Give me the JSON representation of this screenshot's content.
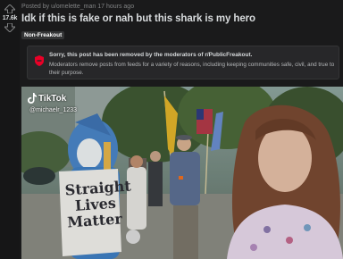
{
  "vote": {
    "score": "17.6k"
  },
  "post": {
    "meta": "Posted by u/omelette_man 17 hours ago",
    "title": "Idk if this is fake or nah but this shark is my hero",
    "flair": "Non-Freakout"
  },
  "removal_notice": {
    "heading": "Sorry, this post has been removed by the moderators of r/PublicFreakout.",
    "body": "Moderators remove posts from feeds for a variety of reasons, including keeping communities safe, civil, and true to their purpose."
  },
  "video": {
    "watermark_brand": "TikTok",
    "watermark_handle": "@michaelr_1233",
    "sign_lines": [
      "Straight",
      "Lives",
      "Matter"
    ]
  },
  "colors": {
    "accent_removed": "#ea0027",
    "background": "#1a1a1b"
  },
  "icons": {
    "upvote": "upvote-arrow-icon",
    "downvote": "downvote-arrow-icon",
    "removed": "shield-removed-icon",
    "tiktok": "tiktok-logo-icon"
  }
}
